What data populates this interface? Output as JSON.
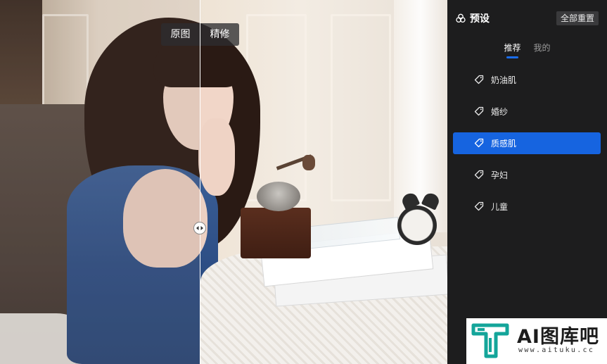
{
  "compare": {
    "before_label": "原图",
    "after_label": "精修"
  },
  "panel": {
    "title": "预设",
    "title_icon": "presets-icon",
    "reset_label": "全部重置",
    "tabs": [
      {
        "label": "推荐",
        "active": true
      },
      {
        "label": "我的",
        "active": false
      }
    ],
    "presets": [
      {
        "label": "奶油肌",
        "icon": "tag-icon",
        "selected": false
      },
      {
        "label": "婚纱",
        "icon": "tag-icon",
        "selected": false
      },
      {
        "label": "质感肌",
        "icon": "tag-icon",
        "selected": true
      },
      {
        "label": "孕妇",
        "icon": "tag-icon",
        "selected": false
      },
      {
        "label": "儿童",
        "icon": "tag-icon",
        "selected": false
      }
    ]
  },
  "watermark": {
    "brand": "AI图库吧",
    "url": "www.aituku.cc"
  },
  "colors": {
    "accent": "#1664e0",
    "panel_bg": "#1d1d1e",
    "watermark_teal": "#14a59a"
  }
}
